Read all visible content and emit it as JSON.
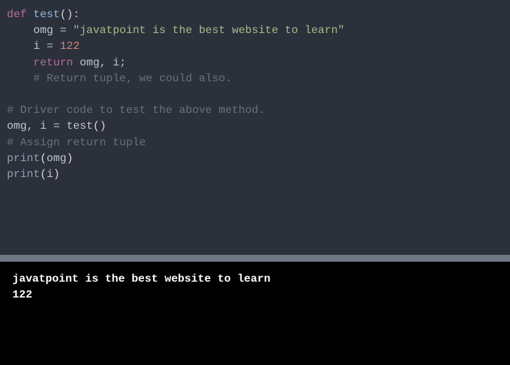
{
  "code": {
    "l1_def": "def",
    "l1_func": " test",
    "l1_paren": "()",
    "l1_colon": ":",
    "l2_indent": "    ",
    "l2_var": "omg ",
    "l2_eq": "=",
    "l2_str": " \"javatpoint is the best website to learn\"",
    "l3_indent": "    ",
    "l3_var": "i ",
    "l3_eq": "=",
    "l3_sp": " ",
    "l3_num": "122",
    "l4_indent": "    ",
    "l4_return": "return",
    "l4_vars": " omg, i",
    "l4_semi": ";",
    "l5_indent": "    ",
    "l5_comment": "# Return tuple, we could also.",
    "l6": "",
    "l7_comment": "# Driver code to test the above method.",
    "l8_lhs": "omg, i ",
    "l8_eq": "=",
    "l8_sp": " ",
    "l8_call": "test",
    "l8_paren": "()",
    "l9_comment": "# Assign return tuple",
    "l10_print": "print",
    "l10_open": "(",
    "l10_arg": "omg",
    "l10_close": ")",
    "l11_print": "print",
    "l11_open": "(",
    "l11_arg": "i",
    "l11_close": ")"
  },
  "output": {
    "line1": "javatpoint is the best website to learn",
    "line2": "122"
  }
}
